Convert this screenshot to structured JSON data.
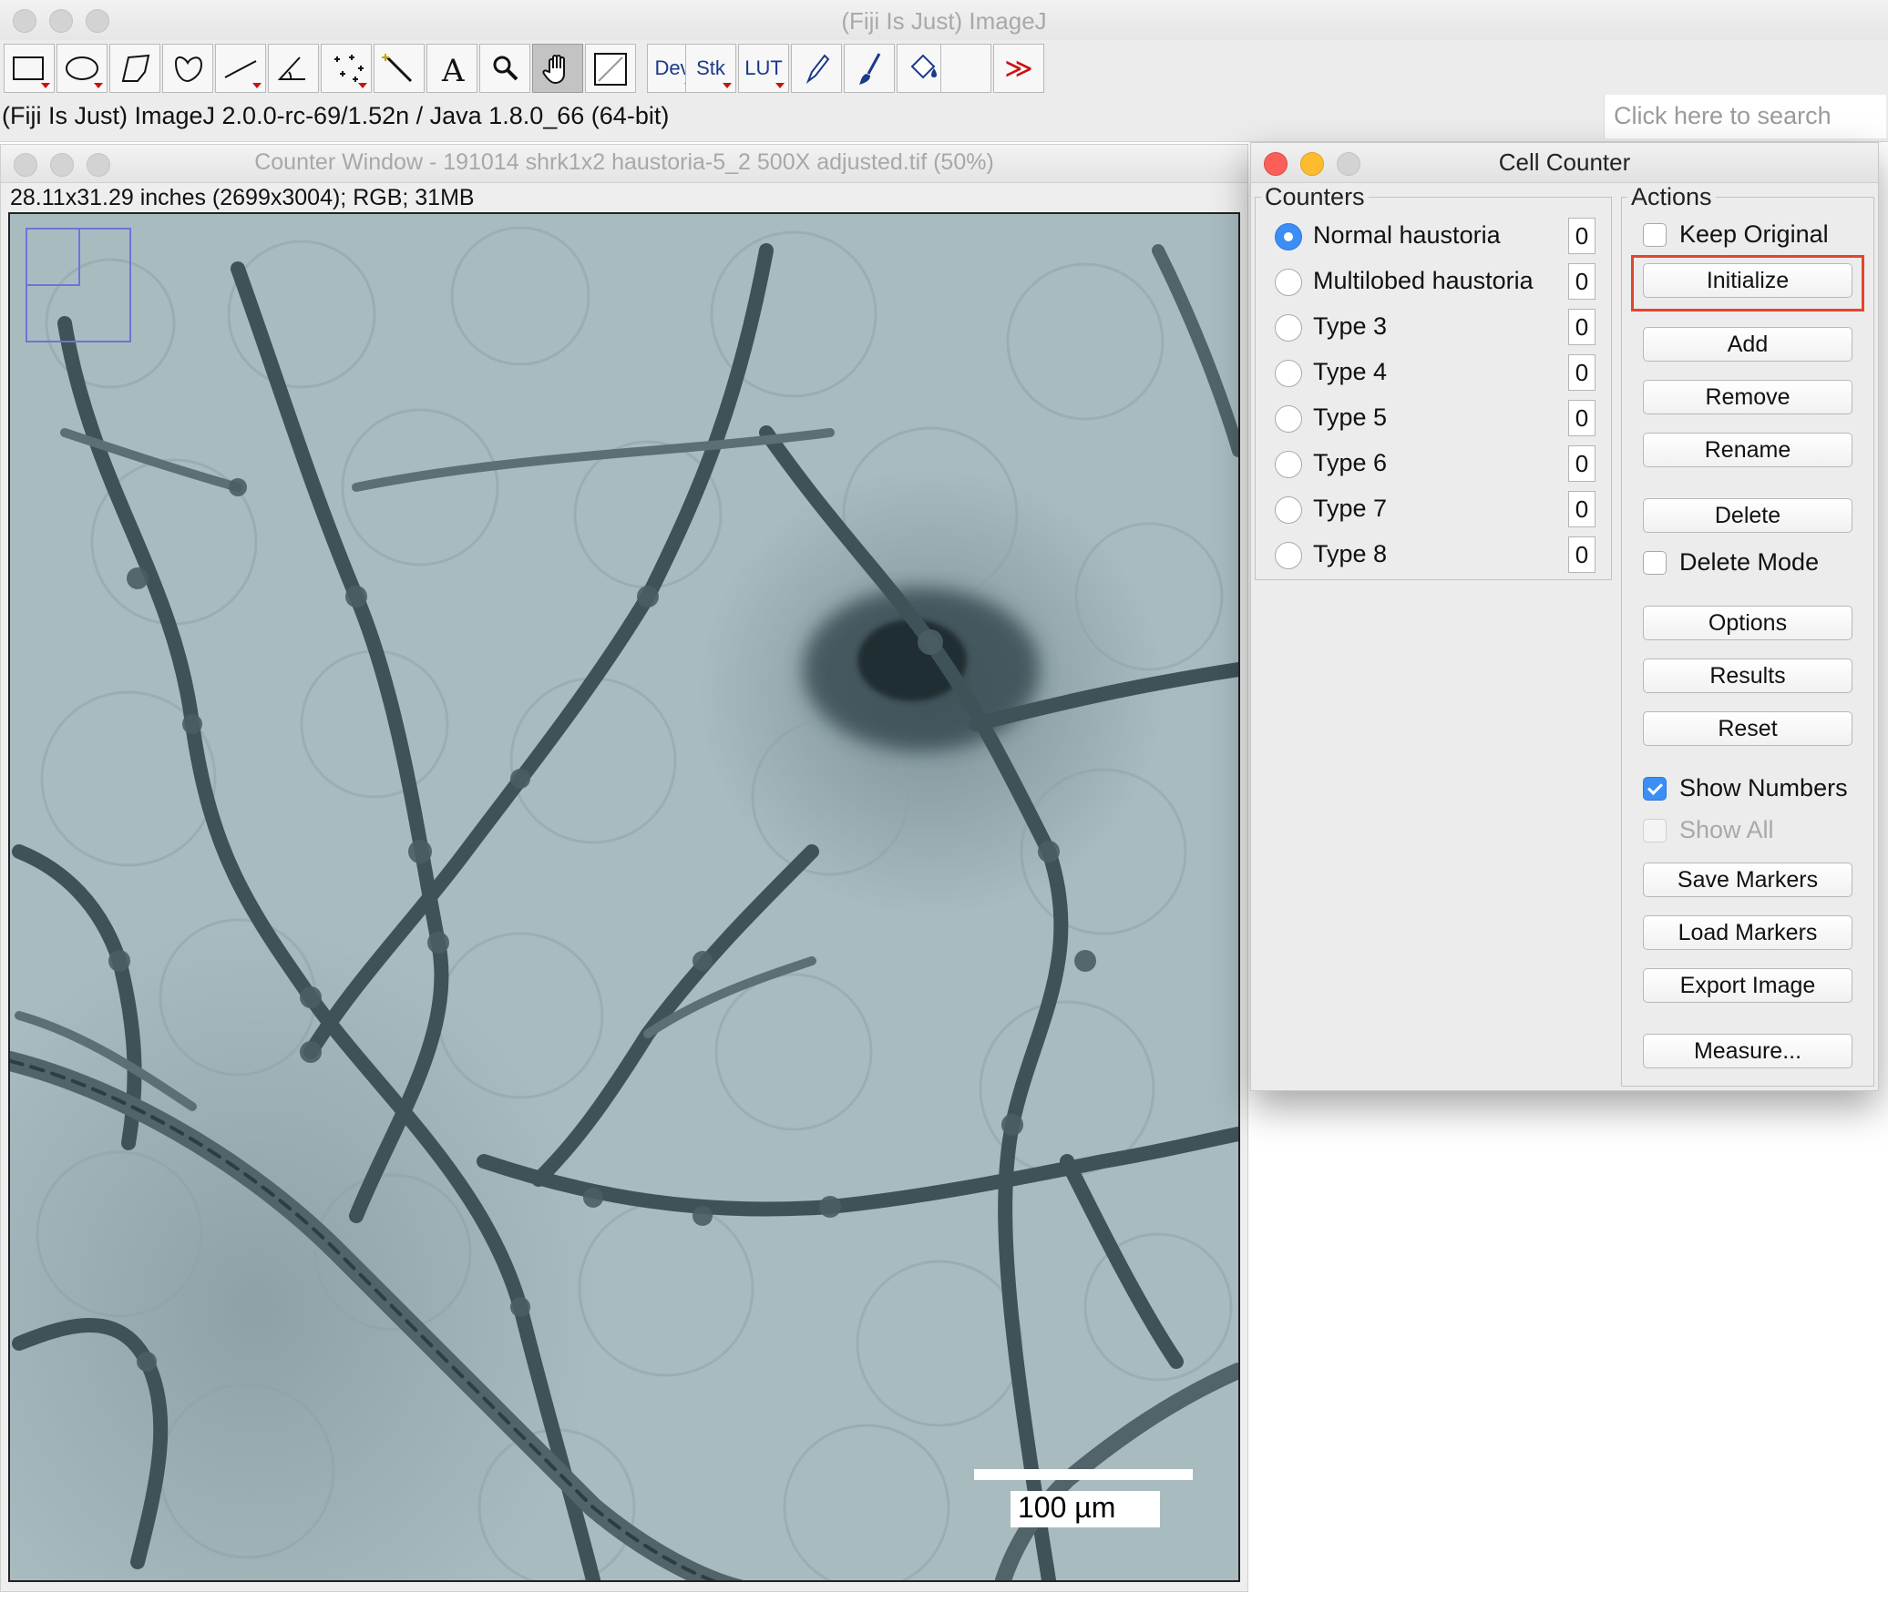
{
  "fiji": {
    "title": "(Fiji Is Just) ImageJ",
    "status": "(Fiji Is Just) ImageJ 2.0.0-rc-69/1.52n / Java 1.8.0_66 (64-bit)",
    "search_placeholder": "Click here to search",
    "toolbar": {
      "tools": [
        "rectangle-icon",
        "oval-icon",
        "polygon-icon",
        "freehand-icon",
        "line-icon",
        "angle-icon",
        "multipoint-icon",
        "wand-icon",
        "text-icon",
        "magnifier-icon",
        "hand-icon",
        "color-picker-icon"
      ],
      "dev_label": "Dev",
      "stk_label": "Stk",
      "lut_label": "LUT",
      "more_label": "≫",
      "selected_tool": "hand-icon"
    }
  },
  "counter_window": {
    "title": "Counter Window - 191014 shrk1x2 haustoria-5_2 500X adjusted.tif (50%)",
    "info": "28.11x31.29 inches (2699x3004); RGB; 31MB",
    "scale_bar_label": "100 µm"
  },
  "cell_counter": {
    "title": "Cell Counter",
    "counters_legend": "Counters",
    "actions_legend": "Actions",
    "counters": [
      {
        "label": "Normal haustoria",
        "count": "0",
        "selected": true
      },
      {
        "label": "Multilobed haustoria",
        "count": "0",
        "selected": false
      },
      {
        "label": "Type 3",
        "count": "0",
        "selected": false
      },
      {
        "label": "Type 4",
        "count": "0",
        "selected": false
      },
      {
        "label": "Type 5",
        "count": "0",
        "selected": false
      },
      {
        "label": "Type 6",
        "count": "0",
        "selected": false
      },
      {
        "label": "Type 7",
        "count": "0",
        "selected": false
      },
      {
        "label": "Type 8",
        "count": "0",
        "selected": false
      }
    ],
    "actions": {
      "keep_original": "Keep Original",
      "initialize": "Initialize",
      "add": "Add",
      "remove": "Remove",
      "rename": "Rename",
      "delete": "Delete",
      "delete_mode": "Delete Mode",
      "options": "Options",
      "results": "Results",
      "reset": "Reset",
      "show_numbers": "Show Numbers",
      "show_all": "Show All",
      "save_markers": "Save Markers",
      "load_markers": "Load Markers",
      "export_image": "Export Image",
      "measure": "Measure..."
    },
    "state": {
      "keep_original": false,
      "delete_mode": false,
      "show_numbers": true,
      "show_all": false
    }
  },
  "colors": {
    "highlight": "#e2452d",
    "accent": "#3b8ef5",
    "close": "#fc5f57",
    "minimize": "#fdbc2e"
  }
}
